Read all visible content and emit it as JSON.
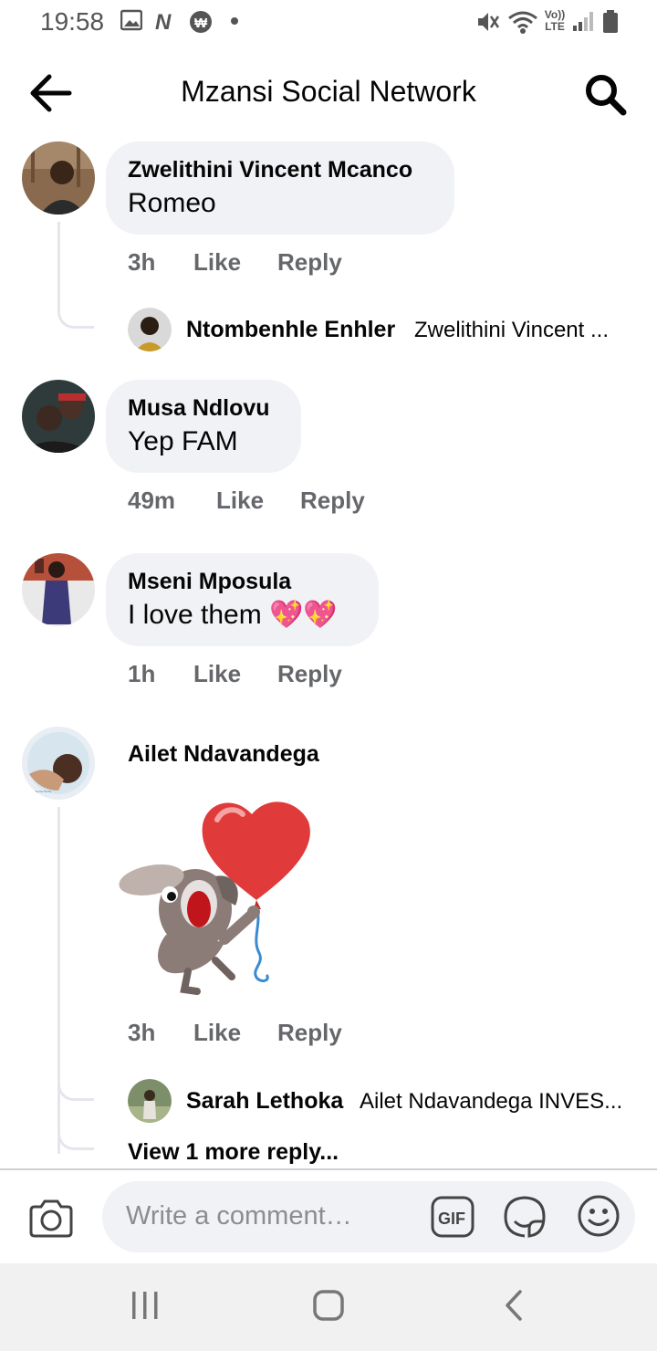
{
  "status_bar": {
    "time": "19:58",
    "carrier_label": "Vo)) LTE"
  },
  "header": {
    "title": "Mzansi Social Network"
  },
  "comments": [
    {
      "name": "Zwelithini Vincent Mcanco",
      "text": "Romeo",
      "time": "3h",
      "like": "Like",
      "reply": "Reply",
      "replies": [
        {
          "name": "Ntombenhle Enhler",
          "preview": "Zwelithini Vincent ..."
        }
      ]
    },
    {
      "name": "Musa Ndlovu",
      "text": "Yep FAM",
      "time": "49m",
      "like": "Like",
      "reply": "Reply"
    },
    {
      "name": "Mseni Mposula",
      "text": "I love them",
      "emoji": "💖💖",
      "time": "1h",
      "like": "Like",
      "reply": "Reply"
    },
    {
      "name": "Ailet Ndavandega",
      "sticker": "dog-with-heart-balloon",
      "time": "3h",
      "like": "Like",
      "reply": "Reply",
      "replies": [
        {
          "name": "Sarah Lethoka",
          "preview": "Ailet Ndavandega INVES..."
        }
      ],
      "view_more": "View 1 more reply..."
    }
  ],
  "composer": {
    "placeholder": "Write a comment…"
  },
  "icons": {
    "back": "arrow-left-icon",
    "search": "search-icon",
    "camera": "camera-icon",
    "gif": "gif-icon",
    "sticker": "sticker-icon",
    "emoji": "emoji-icon"
  },
  "colors": {
    "meta_text": "#65676b",
    "bubble": "#f0f2f5",
    "thread_line": "#e4e6eb"
  }
}
